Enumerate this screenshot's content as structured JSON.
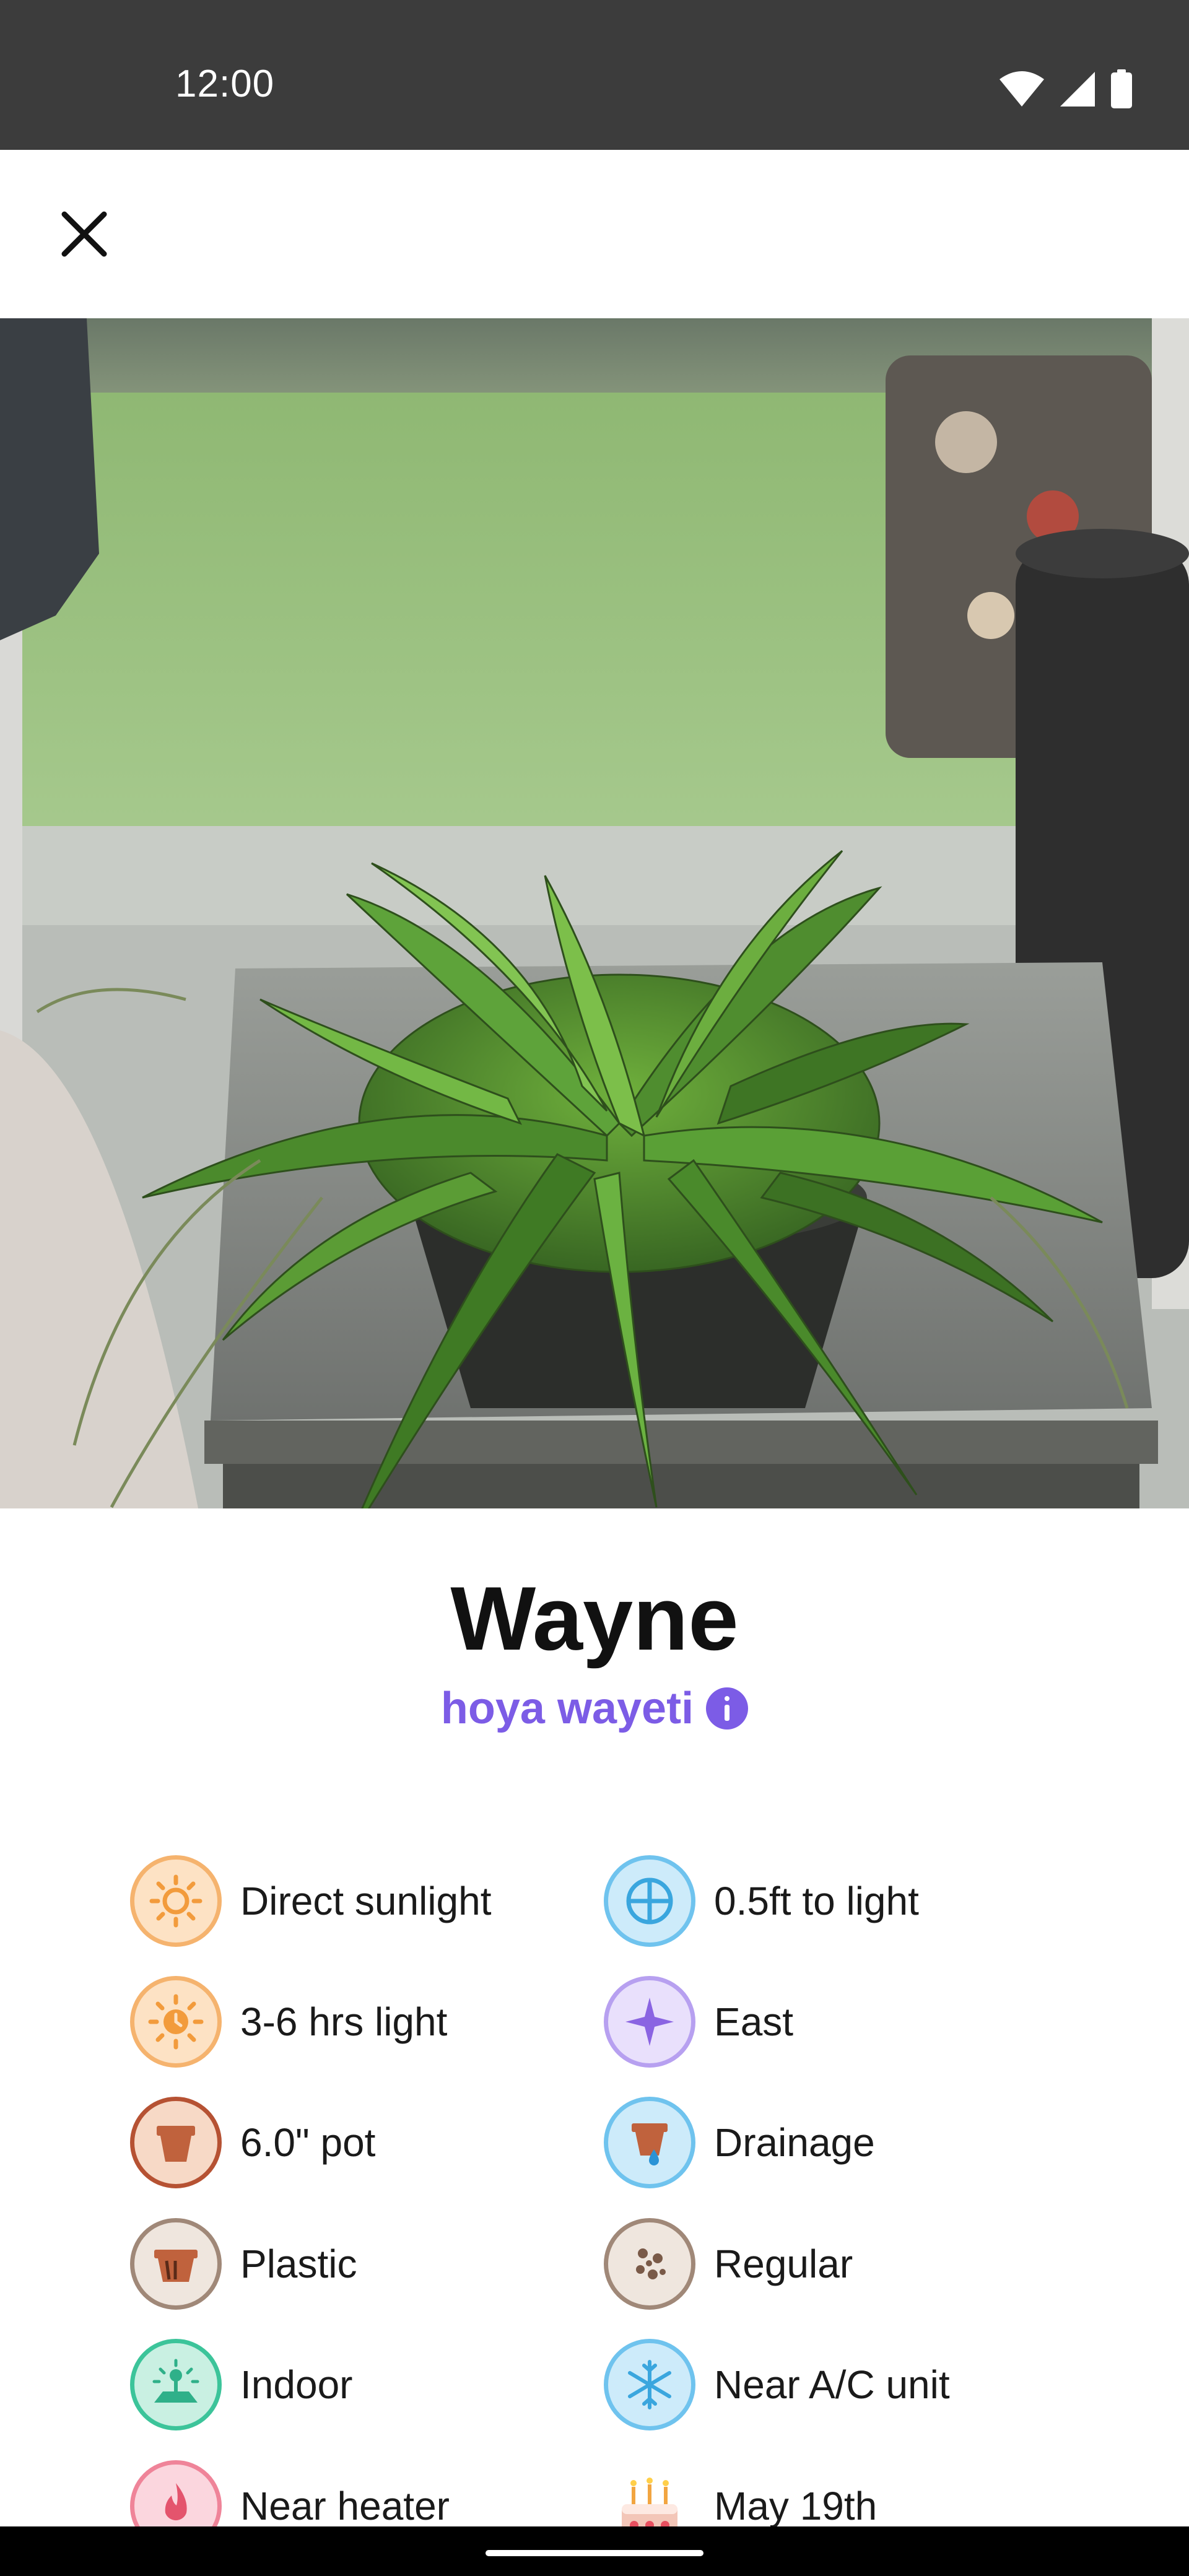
{
  "status_bar": {
    "time": "12:00"
  },
  "plant": {
    "name": "Wayne",
    "species": "hoya wayeti"
  },
  "attributes": [
    {
      "label": "Direct sunlight",
      "icon": "sun-icon",
      "color": "#f5a352"
    },
    {
      "label": "0.5ft to light",
      "icon": "window-icon",
      "color": "#4fb3e8"
    },
    {
      "label": "3-6 hrs light",
      "icon": "sun-clock-icon",
      "color": "#f5a352"
    },
    {
      "label": "East",
      "icon": "compass-star-icon",
      "color": "#9b7ae8"
    },
    {
      "label": "6.0\" pot",
      "icon": "pot-icon",
      "color": "#c0623d"
    },
    {
      "label": "Drainage",
      "icon": "pot-drainage-icon",
      "color": "#4fb3e8"
    },
    {
      "label": "Plastic",
      "icon": "plastic-pot-icon",
      "color": "#a08878"
    },
    {
      "label": "Regular",
      "icon": "soil-icon",
      "color": "#a08878"
    },
    {
      "label": "Indoor",
      "icon": "indoor-plant-icon",
      "color": "#3cc49a"
    },
    {
      "label": "Near A/C unit",
      "icon": "snowflake-icon",
      "color": "#4fb3e8"
    },
    {
      "label": "Near heater",
      "icon": "flame-icon",
      "color": "#e9576f"
    },
    {
      "label": "May 19th",
      "icon": "birthday-cake-icon",
      "color": "#e9576f"
    }
  ]
}
